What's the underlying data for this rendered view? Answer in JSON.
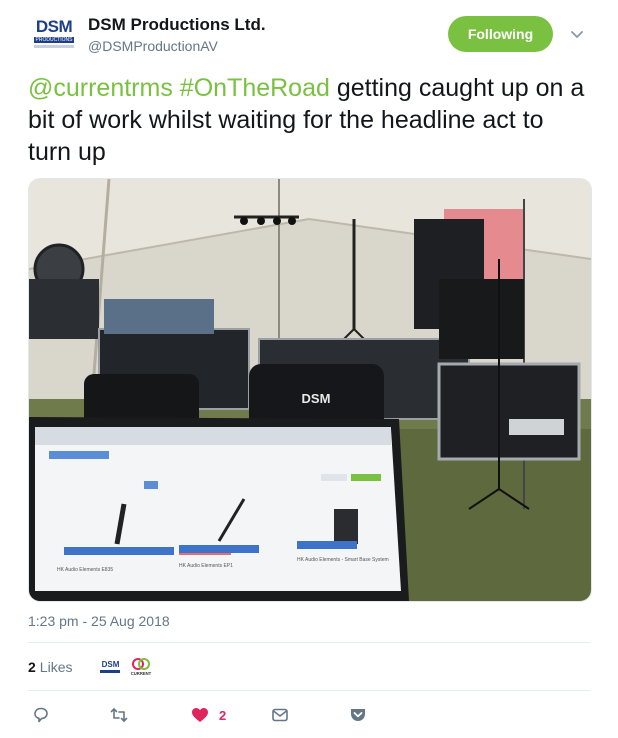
{
  "header": {
    "avatar_text": "DSM",
    "avatar_subtext": "PRODUCTIONS",
    "display_name": "DSM Productions Ltd.",
    "handle": "@DSMProductionAV",
    "follow_label": "Following"
  },
  "tweet": {
    "mention": "@currentrms",
    "hashtag": "#OnTheRoad",
    "text": " getting caught up on a bit of work whilst waiting for the headline act to turn up"
  },
  "media": {
    "chair_text": "DSM",
    "laptop_items": [
      "HK Audio Elements E835",
      "HK Audio Elements EP1",
      "HK Audio Elements - Smart Base System"
    ]
  },
  "timestamp": "1:23 pm - 25 Aug 2018",
  "engagement": {
    "likes_count": "2",
    "likes_label": "Likes",
    "liker_1": "DSM",
    "liker_2": "CURRENT"
  },
  "actions": {
    "reply_icon": "reply-icon",
    "retweet_icon": "retweet-icon",
    "like_icon": "heart-icon",
    "like_count": "2",
    "message_icon": "envelope-icon",
    "save_icon": "pocket-icon"
  },
  "colors": {
    "accent": "#7ac142",
    "like": "#e0245e",
    "muted": "#657786"
  }
}
